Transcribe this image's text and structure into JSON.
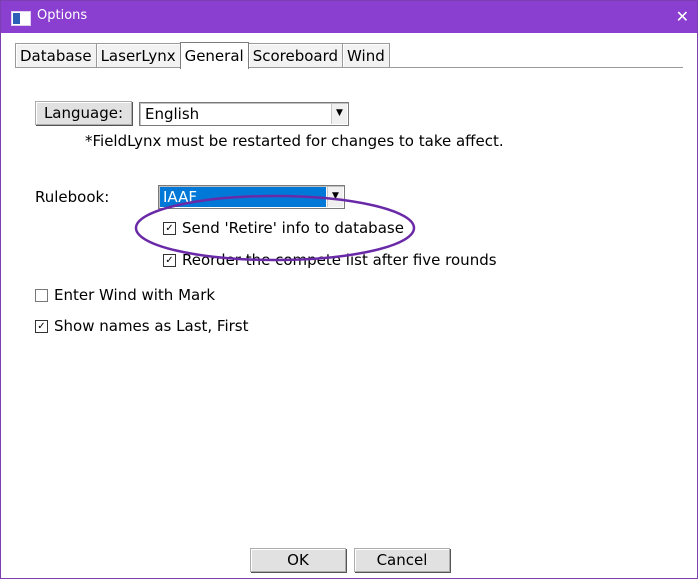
{
  "window": {
    "title": "Options",
    "close_glyph": "✕"
  },
  "tabs": [
    "Database",
    "LaserLynx",
    "General",
    "Scoreboard",
    "Wind"
  ],
  "language": {
    "button_label": "Language:",
    "selected": "English",
    "note": "*FieldLynx must be restarted for changes to take affect."
  },
  "rulebook": {
    "label": "Rulebook:",
    "selected": "IAAF"
  },
  "options": [
    {
      "label": "Send 'Retire' info to database",
      "checked": true
    },
    {
      "label": "Reorder the compete list after five rounds",
      "checked": true
    },
    {
      "label": "Enter Wind with Mark",
      "checked": false
    },
    {
      "label": "Show names as Last, First",
      "checked": true
    }
  ],
  "buttons": {
    "ok": "OK",
    "cancel": "Cancel"
  },
  "annotation": {
    "shape": "ellipse",
    "color": "#6a2aa8"
  },
  "icons": {
    "app": "window-app-icon",
    "close": "close-icon",
    "check": "✓",
    "dropdown": "▼"
  }
}
